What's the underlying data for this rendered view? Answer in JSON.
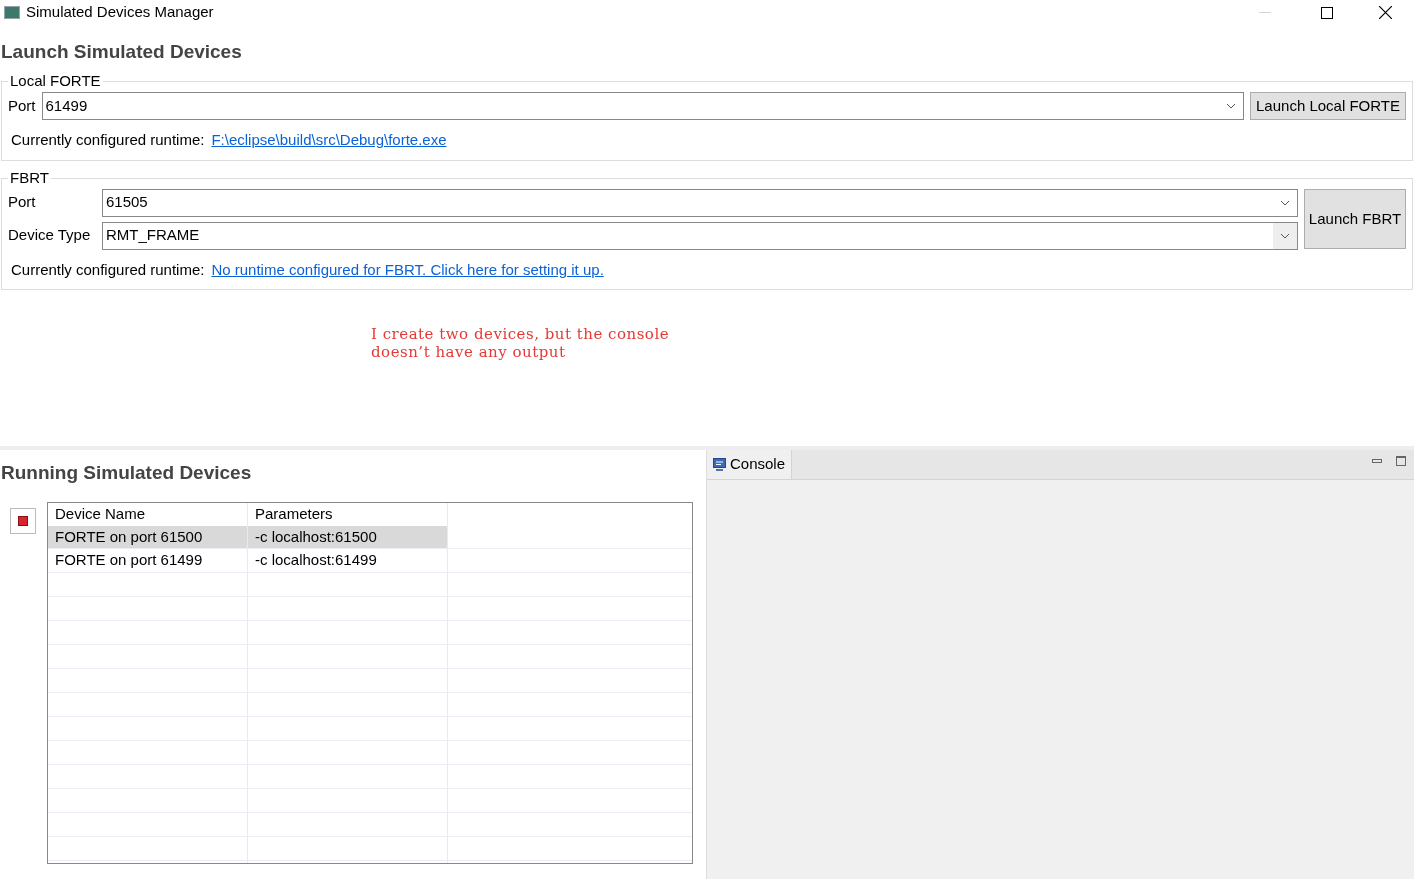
{
  "window": {
    "title": "Simulated Devices Manager"
  },
  "launch": {
    "heading": "Launch Simulated Devices",
    "local_forte": {
      "legend": "Local FORTE",
      "port_label": "Port",
      "port_value": "61499",
      "button": "Launch Local FORTE",
      "runtime_label": "Currently configured runtime:",
      "runtime_link": "F:\\eclipse\\build\\src\\Debug\\forte.exe"
    },
    "fbrt": {
      "legend": "FBRT",
      "port_label": "Port",
      "port_value": "61505",
      "device_type_label": "Device Type",
      "device_type_value": "RMT_FRAME",
      "button": "Launch FBRT",
      "runtime_label": "Currently configured runtime:",
      "runtime_link": "No runtime configured for FBRT. Click here for setting it up."
    }
  },
  "annotation": "I create two devices, but the console\ndoesn’t have any output",
  "running": {
    "heading": "Running Simulated Devices",
    "columns": [
      "Device Name",
      "Parameters"
    ],
    "rows": [
      {
        "cells": [
          "FORTE on port 61500",
          "-c localhost:61500"
        ],
        "selected": true
      },
      {
        "cells": [
          "FORTE on port 61499",
          "-c localhost:61499"
        ],
        "selected": false
      }
    ]
  },
  "console": {
    "tab": "Console"
  }
}
